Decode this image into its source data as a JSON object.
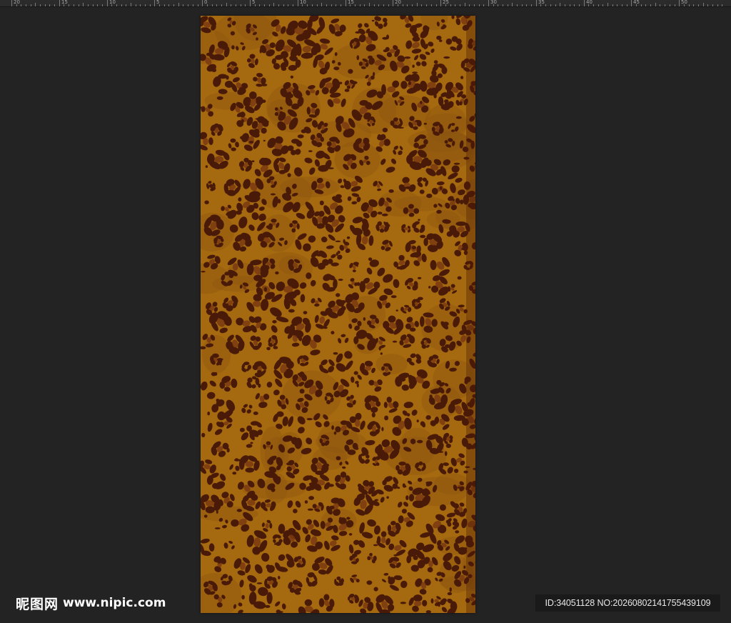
{
  "ruler": {
    "labels": [
      "20",
      "15",
      "10",
      "5",
      "0",
      "5",
      "10",
      "15",
      "20",
      "25",
      "30",
      "35",
      "40",
      "45",
      "50"
    ]
  },
  "document": {
    "pattern": "leopard-print",
    "colors": {
      "base": "#a5690f",
      "spot": "#4a1a08",
      "center": "#7a3a10",
      "shade": "#8a5310"
    }
  },
  "watermark": {
    "logo_cjk": "昵图网",
    "logo_url": "www.nipic.com",
    "id_text": "ID:34051128 NO:20260802141755439109"
  },
  "colors": {
    "workspace": "#232323",
    "ruler": "#2b2b2b"
  }
}
